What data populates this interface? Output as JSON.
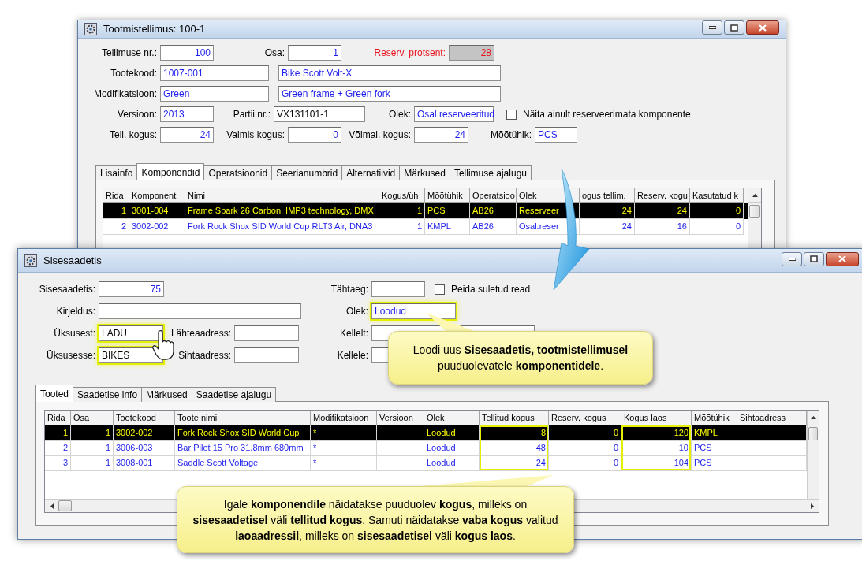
{
  "order_window": {
    "title": "Tootmistellimus: 100-1",
    "form_rows": [
      [
        {
          "label": "Tellimuse nr.:",
          "value": "100",
          "kind": "number"
        },
        {
          "label": "Osa:",
          "value": "1",
          "kind": "number"
        },
        {
          "label": "Reserv. protsent:",
          "value": "28",
          "kind": "readonly"
        }
      ],
      [
        {
          "label": "Tootekood:",
          "value": "1007-001",
          "kind": "text"
        },
        {
          "value": "Bike Scott Volt-X",
          "kind": "text"
        }
      ],
      [
        {
          "label": "Modifikatsioon:",
          "value": "Green",
          "kind": "text"
        },
        {
          "value": "Green frame + Green fork",
          "kind": "text"
        }
      ],
      [
        {
          "label": "Versioon:",
          "value": "2013",
          "kind": "text"
        },
        {
          "label": "Partii nr.:",
          "value": "VX131101-1",
          "kind": "plain"
        },
        {
          "label": "Olek:",
          "value": "Osal.reserveeritud",
          "kind": "text"
        },
        {
          "label": "Näita ainult reserveerimata komponente",
          "kind": "checkbox",
          "checked": false
        }
      ],
      [
        {
          "label": "Tell. kogus:",
          "value": "24",
          "kind": "number"
        },
        {
          "label": "Valmis kogus:",
          "value": "0",
          "kind": "number"
        },
        {
          "label": "Võimal. kogus:",
          "value": "24",
          "kind": "number"
        },
        {
          "label": "Mõõtühik:",
          "value": "PCS",
          "kind": "text"
        }
      ]
    ],
    "tabs": [
      {
        "label": "Lisainfo",
        "selected": false
      },
      {
        "label": "Komponendid",
        "selected": true
      },
      {
        "label": "Operatsioonid",
        "selected": false
      },
      {
        "label": "Seerianumbrid",
        "selected": false
      },
      {
        "label": "Alternatiivid",
        "selected": false
      },
      {
        "label": "Märkused",
        "selected": false
      },
      {
        "label": "Tellimuse ajalugu",
        "selected": false
      }
    ],
    "table": {
      "columns": [
        {
          "label": "Rida",
          "kind": "number"
        },
        {
          "label": "Komponent",
          "kind": "text"
        },
        {
          "label": "Nimi",
          "kind": "text"
        },
        {
          "label": "Kogus/üh",
          "kind": "number"
        },
        {
          "label": "Mõõtühik",
          "kind": "text"
        },
        {
          "label": "Operatsioo",
          "kind": "text"
        },
        {
          "label": "Olek",
          "kind": "text"
        },
        {
          "label": "ogus tellim.",
          "kind": "number"
        },
        {
          "label": "Reserv. kogu",
          "kind": "number"
        },
        {
          "label": "Kasutatud k",
          "kind": "number"
        }
      ],
      "rows": [
        {
          "selected": true,
          "cells": [
            "1",
            "3001-004",
            "Frame Spark 26 Carbon, IMP3 technology, DMX",
            "1",
            "PCS",
            "AB26",
            "Reserveer",
            "24",
            "24",
            "0"
          ]
        },
        {
          "selected": false,
          "cells": [
            "2",
            "3002-002",
            "Fork Rock Shox SID World Cup RLT3 Air, DNA3",
            "1",
            "KMPL",
            "AB26",
            "Osal.reser",
            "24",
            "16",
            "0"
          ]
        }
      ]
    }
  },
  "transfer_window": {
    "title": "Sisesaadetis",
    "form_left": [
      [
        {
          "label": "Sisesaadetis:",
          "value": "75",
          "kind": "number",
          "highlighted": false
        }
      ],
      [
        {
          "label": "Kirjeldus:",
          "kind": "text",
          "highlighted": false
        }
      ],
      [
        {
          "label": "Üksusest:",
          "value": "LADU",
          "kind": "plain",
          "highlighted": true
        },
        {
          "label": "Lähteaadress:",
          "kind": "text",
          "highlighted": false
        }
      ],
      [
        {
          "label": "Üksusesse:",
          "value": "BIKES",
          "kind": "plain",
          "highlighted": true
        },
        {
          "label": "Sihtaadress:",
          "kind": "text",
          "highlighted": false
        }
      ]
    ],
    "form_right": [
      [
        {
          "label": "Tähtaeg:",
          "kind": "text",
          "highlighted": false
        },
        {
          "label": "Peida suletud read",
          "kind": "checkbox",
          "checked": false
        }
      ],
      [
        {
          "label": "Olek:",
          "value": "Loodud",
          "kind": "text",
          "highlighted": true
        }
      ],
      [
        {
          "label": "Kellelt:",
          "kind": "text",
          "highlighted": false
        }
      ],
      [
        {
          "label": "Kellele:",
          "kind": "text",
          "highlighted": false
        }
      ]
    ],
    "tabs": [
      {
        "label": "Tooted",
        "selected": true
      },
      {
        "label": "Saadetise info",
        "selected": false
      },
      {
        "label": "Märkused",
        "selected": false
      },
      {
        "label": "Saadetise ajalugu",
        "selected": false
      }
    ],
    "table": {
      "columns": [
        {
          "label": "Rida",
          "kind": "number",
          "highlighted": false
        },
        {
          "label": "Osa",
          "kind": "number",
          "highlighted": false
        },
        {
          "label": "Tootekood",
          "kind": "text",
          "highlighted": false
        },
        {
          "label": "Toote nimi",
          "kind": "text",
          "highlighted": false
        },
        {
          "label": "Modifikatsioon",
          "kind": "text",
          "highlighted": false
        },
        {
          "label": "Versioon",
          "kind": "text",
          "highlighted": false
        },
        {
          "label": "Olek",
          "kind": "text",
          "highlighted": false
        },
        {
          "label": "Tellitud kogus",
          "kind": "number",
          "highlighted": true
        },
        {
          "label": "Reserv. kogus",
          "kind": "number",
          "highlighted": false
        },
        {
          "label": "Kogus laos",
          "kind": "number",
          "highlighted": true
        },
        {
          "label": "Mõõtühik",
          "kind": "text",
          "highlighted": false
        },
        {
          "label": "Sihtaadress",
          "kind": "text",
          "highlighted": false
        }
      ],
      "rows": [
        {
          "selected": true,
          "cells": [
            "1",
            "1",
            "3002-002",
            "Fork Rock Shox SID World Cup",
            "*",
            "",
            "Loodud",
            "8",
            "0",
            "120",
            "KMPL",
            ""
          ]
        },
        {
          "selected": false,
          "cells": [
            "2",
            "1",
            "3006-003",
            "Bar Pilot 15 Pro 31.8mm 680mm",
            "*",
            "",
            "Loodud",
            "48",
            "0",
            "10",
            "PCS",
            ""
          ]
        },
        {
          "selected": false,
          "cells": [
            "3",
            "1",
            "3008-001",
            "Saddle Scott Voltage",
            "*",
            "",
            "Loodud",
            "24",
            "0",
            "104",
            "PCS",
            ""
          ]
        }
      ]
    }
  },
  "callouts": [
    {
      "text": "Loodi uus **Sisesaadetis, tootmistellimusel** puuduolevatele **komponentidele**."
    },
    {
      "text": "Igale **komponendile** näidatakse puuduolev **kogus**, milleks on **sisesaadetisel** väli **tellitud kogus**. Samuti näidatakse **vaba kogus** valitud **laoaadressil**, milleks on **sisesaadetisel** väli **kogus laos**."
    }
  ]
}
